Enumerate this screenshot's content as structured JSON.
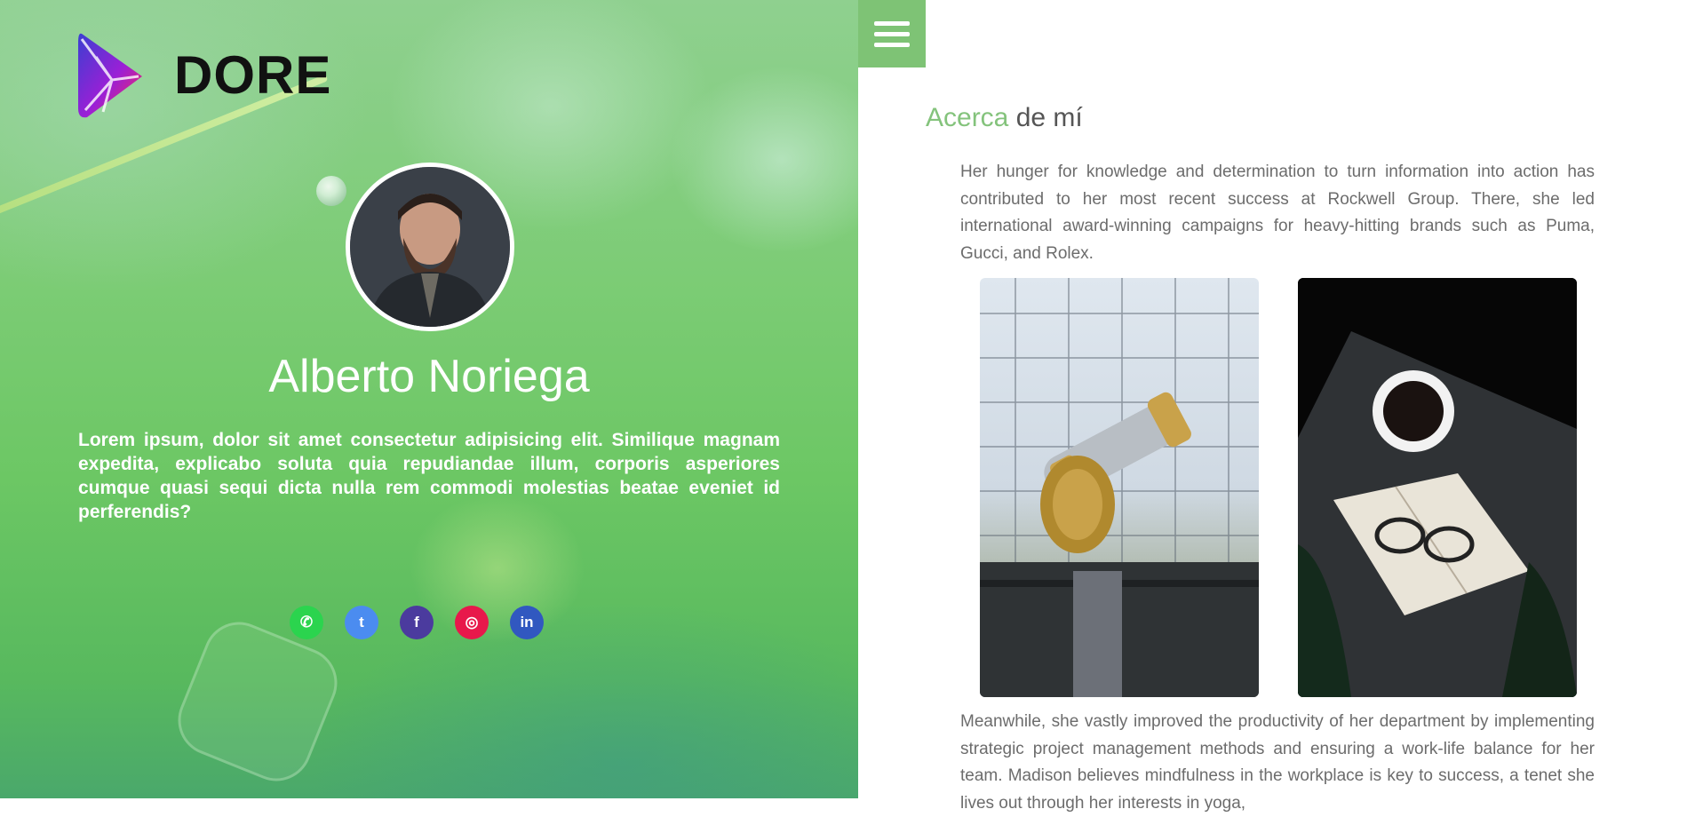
{
  "brand": {
    "name": "DORE",
    "colors": {
      "accent_green": "#84c37c",
      "menu_bg": "#7ec375",
      "logo_gradient": [
        "#3b3fd1",
        "#9b1fd6",
        "#ff2a4f"
      ]
    }
  },
  "hero": {
    "person_name": "Alberto Noriega",
    "bio": "Lorem ipsum, dolor sit amet consectetur adipisicing elit. Similique magnam expedita, explicabo soluta quia repudiandae illum, corporis asperiores cumque quasi sequi dicta nulla rem commodi molestias beatae eveniet id perferendis?",
    "avatar_icon": "person-photo",
    "social": [
      {
        "name": "whatsapp",
        "glyph": "✆",
        "color": "#2bd44e"
      },
      {
        "name": "twitter",
        "glyph": "t",
        "color": "#4b8cf0"
      },
      {
        "name": "facebook",
        "glyph": "f",
        "color": "#4b3b9e"
      },
      {
        "name": "instagram",
        "glyph": "◎",
        "color": "#e8184b"
      },
      {
        "name": "linkedin",
        "glyph": "in",
        "color": "#3158c0"
      }
    ]
  },
  "menu": {
    "icon": "hamburger-menu-icon"
  },
  "about": {
    "title_accent": "Acerca",
    "title_rest": " de mí",
    "paragraph_1": "Her hunger for knowledge and determination to turn information into action has contributed to her most recent success at Rockwell Group. There, she led international award-winning campaigns for heavy-hitting brands such as Puma, Gucci, and Rolex.",
    "paragraph_2": "Meanwhile, she vastly improved the productivity of her department by implementing strategic project management methods and ensuring a work-life balance for her team. Madison believes mindfulness in the workplace is key to success, a tenet she lives out through her interests in yoga,",
    "photos": [
      "binoculars-photo",
      "coffee-book-glasses-photo"
    ]
  }
}
